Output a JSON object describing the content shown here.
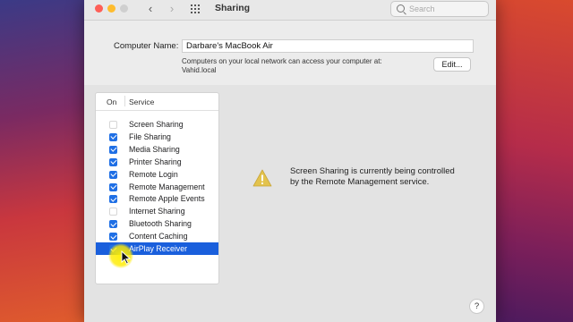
{
  "window": {
    "title": "Sharing",
    "search": {
      "placeholder": "Search"
    }
  },
  "computer": {
    "name_label": "Computer Name:",
    "name_value": "Darbare's MacBook Air",
    "note_line1": "Computers on your local network can access your computer at:",
    "note_line2": "Vahid.local",
    "edit_label": "Edit..."
  },
  "services": {
    "header_on": "On",
    "header_service": "Service",
    "items": [
      {
        "name": "Screen Sharing",
        "on": false,
        "selected": false
      },
      {
        "name": "File Sharing",
        "on": true,
        "selected": false
      },
      {
        "name": "Media Sharing",
        "on": true,
        "selected": false
      },
      {
        "name": "Printer Sharing",
        "on": true,
        "selected": false
      },
      {
        "name": "Remote Login",
        "on": true,
        "selected": false
      },
      {
        "name": "Remote Management",
        "on": true,
        "selected": false
      },
      {
        "name": "Remote Apple Events",
        "on": true,
        "selected": false
      },
      {
        "name": "Internet Sharing",
        "on": false,
        "selected": false
      },
      {
        "name": "Bluetooth Sharing",
        "on": true,
        "selected": false
      },
      {
        "name": "Content Caching",
        "on": true,
        "selected": false
      },
      {
        "name": "AirPlay Receiver",
        "on": true,
        "selected": true
      }
    ]
  },
  "detail": {
    "message_line1": "Screen Sharing is currently being controlled",
    "message_line2": "by the Remote Management service."
  },
  "help": {
    "label": "?"
  },
  "colors": {
    "accent": "#1f6fe5",
    "selection": "#1a5fdc",
    "warning": "#e3c34d"
  }
}
